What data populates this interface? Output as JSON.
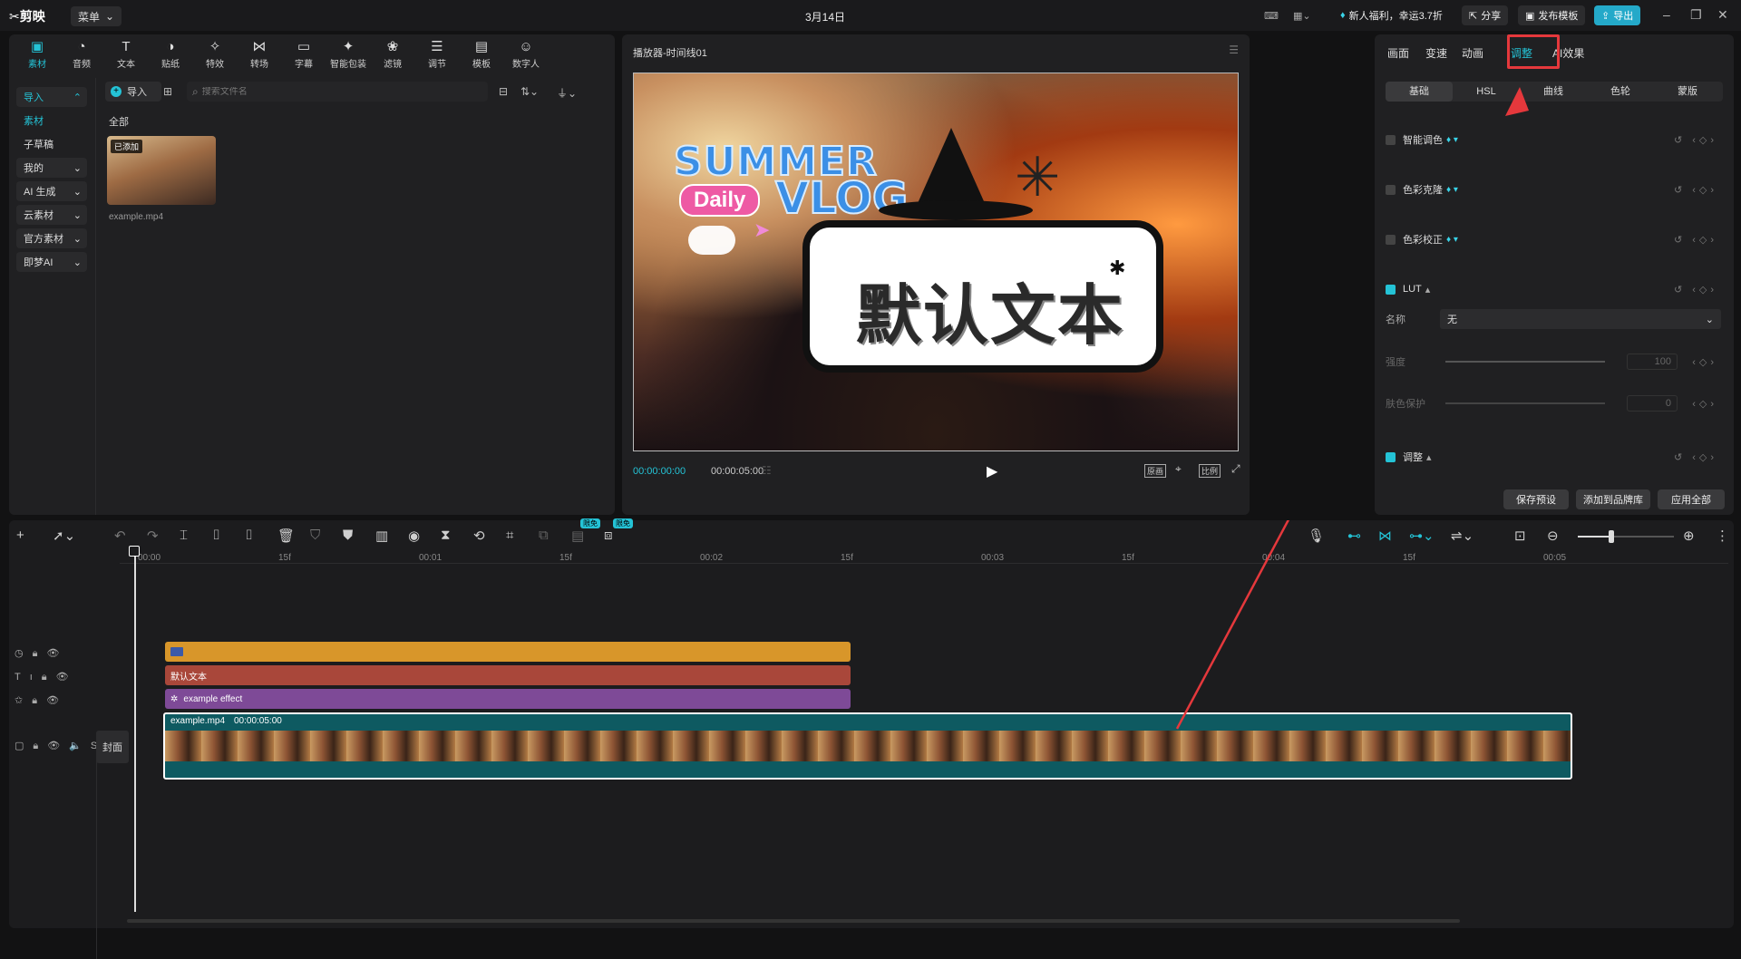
{
  "titlebar": {
    "app_name": "剪映",
    "menu_label": "菜单",
    "date": "3月14日",
    "promo": "新人福利，幸运3.7折",
    "share": "分享",
    "publish_template": "发布模板",
    "export": "导出"
  },
  "toolbar": {
    "tabs": [
      {
        "label": "素材",
        "icon": "media-icon",
        "active": true
      },
      {
        "label": "音频",
        "icon": "audio-icon"
      },
      {
        "label": "文本",
        "icon": "text-icon"
      },
      {
        "label": "贴纸",
        "icon": "sticker-icon"
      },
      {
        "label": "特效",
        "icon": "effects-icon"
      },
      {
        "label": "转场",
        "icon": "transition-icon"
      },
      {
        "label": "字幕",
        "icon": "subtitle-icon"
      },
      {
        "label": "智能包装",
        "icon": "smart-package-icon"
      },
      {
        "label": "滤镜",
        "icon": "filter-icon"
      },
      {
        "label": "调节",
        "icon": "adjust-icon"
      },
      {
        "label": "模板",
        "icon": "template-icon"
      },
      {
        "label": "数字人",
        "icon": "digital-human-icon"
      }
    ]
  },
  "sidebar": {
    "items": [
      {
        "label": "导入",
        "has_caret": true
      },
      {
        "label": "素材",
        "active": true
      },
      {
        "label": "子草稿"
      },
      {
        "label": "我的",
        "has_caret": true
      },
      {
        "label": "AI 生成",
        "has_caret": true
      },
      {
        "label": "云素材",
        "has_caret": true
      },
      {
        "label": "官方素材",
        "has_caret": true
      },
      {
        "label": "即梦AI",
        "has_caret": true
      }
    ]
  },
  "media": {
    "import_label": "导入",
    "search_placeholder": "搜索文件名",
    "section_label": "全部",
    "clip": {
      "badge": "已添加",
      "filename": "example.mp4"
    }
  },
  "player": {
    "title": "播放器-时间线01",
    "current_time": "00:00:00:00",
    "total_time": "00:00:05:00",
    "ratio_label": "比例",
    "original_label": "原画",
    "overlay": {
      "summer": "SUMMER",
      "daily": "Daily",
      "vlog": "VLOG",
      "default_text": "默认文本"
    }
  },
  "right_panel": {
    "tabs": [
      "画面",
      "变速",
      "动画",
      "调整",
      "AI效果"
    ],
    "active_tab": "调整",
    "sub_tabs": [
      "基础",
      "HSL",
      "曲线",
      "色轮",
      "蒙版"
    ],
    "rows": {
      "smart_color": "智能调色",
      "color_clone": "色彩克隆",
      "color_correct": "色彩校正",
      "lut": "LUT",
      "name_label": "名称",
      "name_value": "无",
      "strength_label": "强度",
      "strength_value": "100",
      "skin_label": "肤色保护",
      "skin_value": "0",
      "adjust": "调整"
    },
    "buttons": {
      "save_preset": "保存预设",
      "add_brand": "添加到品牌库",
      "apply_all": "应用全部"
    }
  },
  "timeline": {
    "badge_free": "限免",
    "ruler": [
      "00:00",
      "15f",
      "00:01",
      "15f",
      "00:02",
      "15f",
      "00:03",
      "15f",
      "00:04",
      "15f",
      "00:05"
    ],
    "tracks": {
      "text_clip": "默认文本",
      "effect_clip": "example effect",
      "video_name": "example.mp4",
      "video_duration": "00:00:05:00",
      "cover": "封面"
    }
  },
  "colors": {
    "accent": "#24c3d6",
    "sticker_track": "#d8962a",
    "text_track": "#a9473a",
    "effect_track": "#7e4a97",
    "video_track": "#0e5a61",
    "highlight": "#e5383c"
  }
}
